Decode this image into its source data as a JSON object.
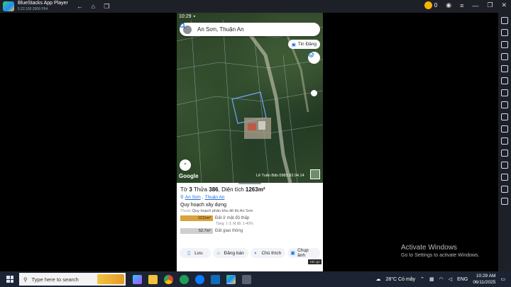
{
  "window": {
    "title": "BlueStacks App Player",
    "subtitle": "5.22.100.2006 P64",
    "coin_count": "0"
  },
  "phone": {
    "status_time": "10:29",
    "search": {
      "value": "An Sơn, Thuận An"
    },
    "tin_dang_label": "Tin Đăng",
    "google_label": "Google",
    "map_watermark": "Lê Tuấn Bđs 0983.92.04.14",
    "parcel": {
      "prefix": "Tờ",
      "sheet": "3",
      "plot_label": "Thửa",
      "plot": "386",
      "area_label": "Diện tích",
      "area": "1263m²"
    },
    "address": {
      "ward": "An Sơn",
      "city": "Thuận An"
    },
    "planning": {
      "section_title": "Quy hoạch xây dựng",
      "source_prefix": "Thuộc",
      "source": "Quy hoạch phân khu đô thị An Sơn",
      "rows": [
        {
          "value": "1211m²",
          "label": "Đất ở mật độ thấp",
          "color": "#d9a33a"
        },
        {
          "value": "52.7m²",
          "label": "Đất giao thông",
          "color": "#cfcfcf"
        }
      ],
      "detail": "Tầng: 1-3, M.độ: 1-40%"
    },
    "actions": [
      {
        "label": "Lưu",
        "icon": "bookmark-icon"
      },
      {
        "label": "Đăng bán",
        "icon": "house-icon"
      },
      {
        "label": "Chú thích",
        "icon": "legend-icon"
      },
      {
        "label": "Chụp ảnh",
        "icon": "camera-icon"
      }
    ],
    "tat_tag": "TẮT QC"
  },
  "activate": {
    "title": "Activate Windows",
    "subtitle": "Go to Settings to activate Windows."
  },
  "taskbar": {
    "search_placeholder": "Type here to search",
    "weather": "28°C  Có mây",
    "lang": "ENG",
    "time": "10:29 AM",
    "date": "06/11/2025"
  }
}
